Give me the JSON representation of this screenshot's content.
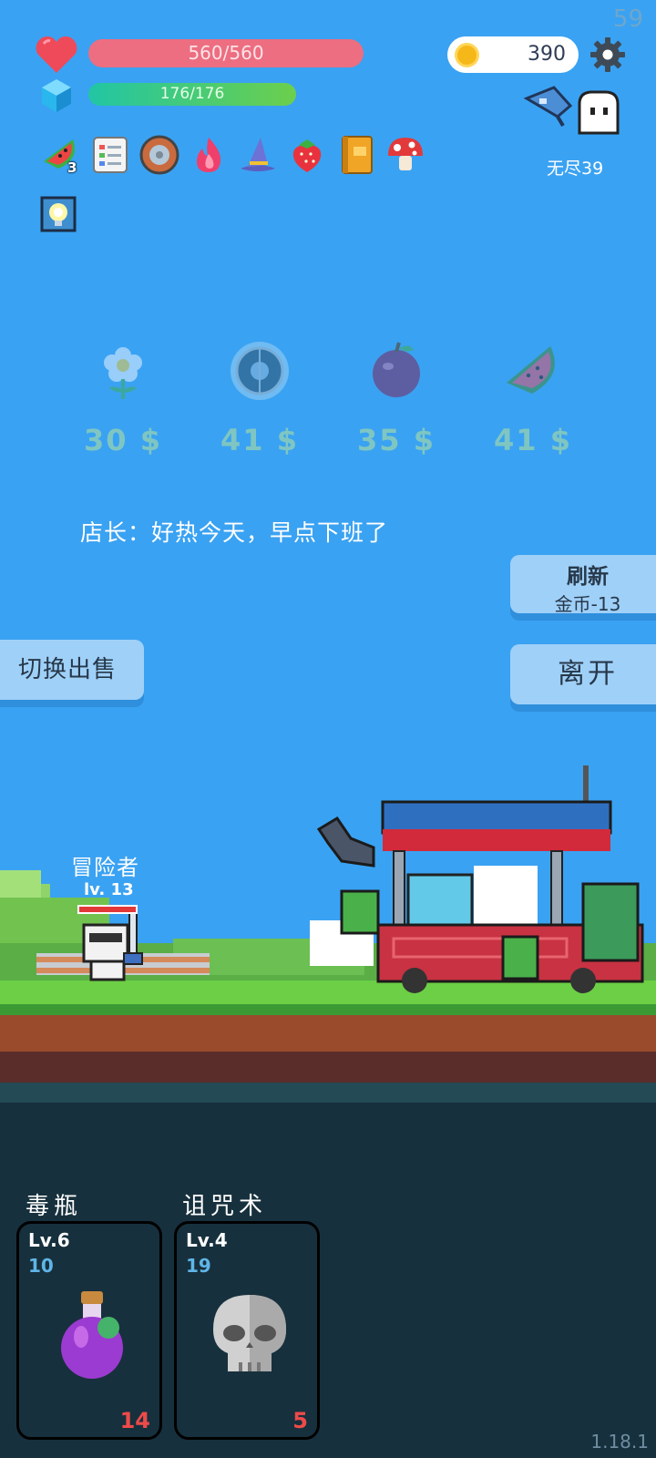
{
  "hud": {
    "fps": "59",
    "hp_text": "560/560",
    "mp_text": "176/176",
    "gold": "390",
    "mode": "无尽39",
    "relics": [
      {
        "icon": "watermelon-slice-icon",
        "count": "3"
      },
      {
        "icon": "notebook-icon"
      },
      {
        "icon": "round-shield-icon"
      },
      {
        "icon": "flame-icon"
      },
      {
        "icon": "wizard-hat-icon"
      },
      {
        "icon": "strawberry-icon"
      },
      {
        "icon": "book-icon"
      },
      {
        "icon": "mushroom-icon"
      }
    ],
    "buff_icon": "lightbulb-icon"
  },
  "shop": {
    "items": [
      {
        "icon": "flower-icon",
        "price": "30 $"
      },
      {
        "icon": "shield-icon",
        "price": "41 $"
      },
      {
        "icon": "plum-icon",
        "price": "35 $"
      },
      {
        "icon": "watermelon-icon",
        "price": "41 $"
      }
    ],
    "shopkeeper_line": "店长：好热今天，早点下班了",
    "refresh_label": "刷新",
    "refresh_cost": "金币-13",
    "leave_label": "离开",
    "switch_label": "切换出售"
  },
  "hero": {
    "name": "冒险者",
    "level": "lv. 13",
    "hp_fraction": 1.0
  },
  "skills": [
    {
      "name": "毒瓶",
      "level": "Lv.6",
      "cost": "10",
      "damage": "14",
      "icon": "poison-bottle-icon"
    },
    {
      "name": "诅咒术",
      "level": "Lv.4",
      "cost": "19",
      "damage": "5",
      "icon": "skull-icon"
    }
  ],
  "version": "1.18.1",
  "colors": {
    "sky": "#3aa2f2",
    "hp_bar": "#ec6e80",
    "mp_bar": "#21c6a4",
    "button": "#9fd0f8",
    "panel": "#17303d",
    "damage": "#ee4a4a",
    "cost": "#5fb5e8"
  }
}
